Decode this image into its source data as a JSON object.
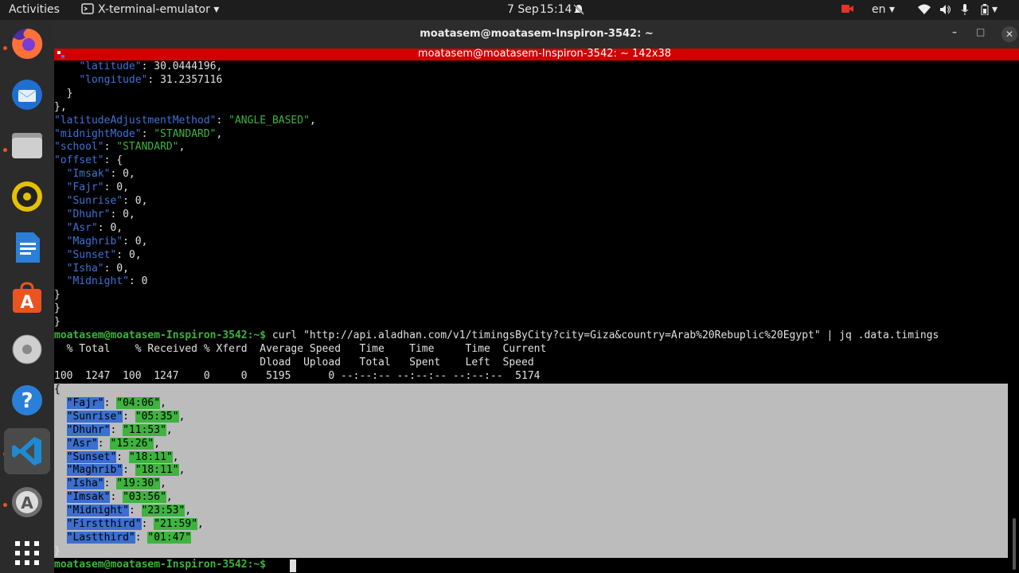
{
  "topbar": {
    "activities": "Activities",
    "app_name": "X-terminal-emulator",
    "date": "7 Sep",
    "time": "15:14",
    "lang": "en"
  },
  "window": {
    "title": "moatasem@moatasem-Inspiron-3542: ~",
    "tab_title": "moatasem@moatasem-Inspiron-3542: ~ 142x38"
  },
  "terminal": {
    "lines_top": [
      "    \"latitude\": 30.0444196,",
      "    \"longitude\": 31.2357116",
      "  }",
      "},",
      "\"latitudeAdjustmentMethod\": \"ANGLE_BASED\",",
      "\"midnightMode\": \"STANDARD\",",
      "\"school\": \"STANDARD\",",
      "\"offset\": {",
      "  \"Imsak\": 0,",
      "  \"Fajr\": 0,",
      "  \"Sunrise\": 0,",
      "  \"Dhuhr\": 0,",
      "  \"Asr\": 0,",
      "  \"Maghrib\": 0,",
      "  \"Sunset\": 0,",
      "  \"Isha\": 0,",
      "  \"Midnight\": 0",
      "}",
      "}",
      "}"
    ],
    "prompt": "moatasem@moatasem-Inspiron-3542:~$",
    "command": " curl \"http://api.aladhan.com/v1/timingsByCity?city=Giza&country=Arab%20Rebuplic%20Egypt\" | jq .data.timings",
    "curl_header1": "  % Total    % Received % Xferd  Average Speed   Time    Time     Time  Current",
    "curl_header2": "                                 Dload  Upload   Total   Spent    Left  Speed",
    "curl_progress": "100  1247  100  1247    0     0   5195      0 --:--:-- --:--:-- --:--:--  5174",
    "open_brace": "{",
    "close_brace": "}",
    "timings": [
      {
        "key": "\"Fajr\"",
        "value": "\"04:06\"",
        "comma": ","
      },
      {
        "key": "\"Sunrise\"",
        "value": "\"05:35\"",
        "comma": ","
      },
      {
        "key": "\"Dhuhr\"",
        "value": "\"11:53\"",
        "comma": ","
      },
      {
        "key": "\"Asr\"",
        "value": "\"15:26\"",
        "comma": ","
      },
      {
        "key": "\"Sunset\"",
        "value": "\"18:11\"",
        "comma": ","
      },
      {
        "key": "\"Maghrib\"",
        "value": "\"18:11\"",
        "comma": ","
      },
      {
        "key": "\"Isha\"",
        "value": "\"19:30\"",
        "comma": ","
      },
      {
        "key": "\"Imsak\"",
        "value": "\"03:56\"",
        "comma": ","
      },
      {
        "key": "\"Midnight\"",
        "value": "\"23:53\"",
        "comma": ","
      },
      {
        "key": "\"Firstthird\"",
        "value": "\"21:59\"",
        "comma": ","
      },
      {
        "key": "\"Lastthird\"",
        "value": "\"01:47\"",
        "comma": ""
      }
    ],
    "final_prompt": "moatasem@moatasem-Inspiron-3542:~$"
  },
  "dock": [
    "firefox-icon",
    "thunderbird-icon",
    "files-icon",
    "rhythmbox-icon",
    "libreoffice-writer-icon",
    "software-center-icon",
    "disks-icon",
    "help-icon",
    "vscode-icon",
    "software-updater-icon",
    "show-apps-icon"
  ],
  "colors": {
    "tab_accent": "#d00000",
    "json_key": "#3f72d6",
    "json_string": "#3eb33e",
    "selection": "#bcbcbc"
  }
}
